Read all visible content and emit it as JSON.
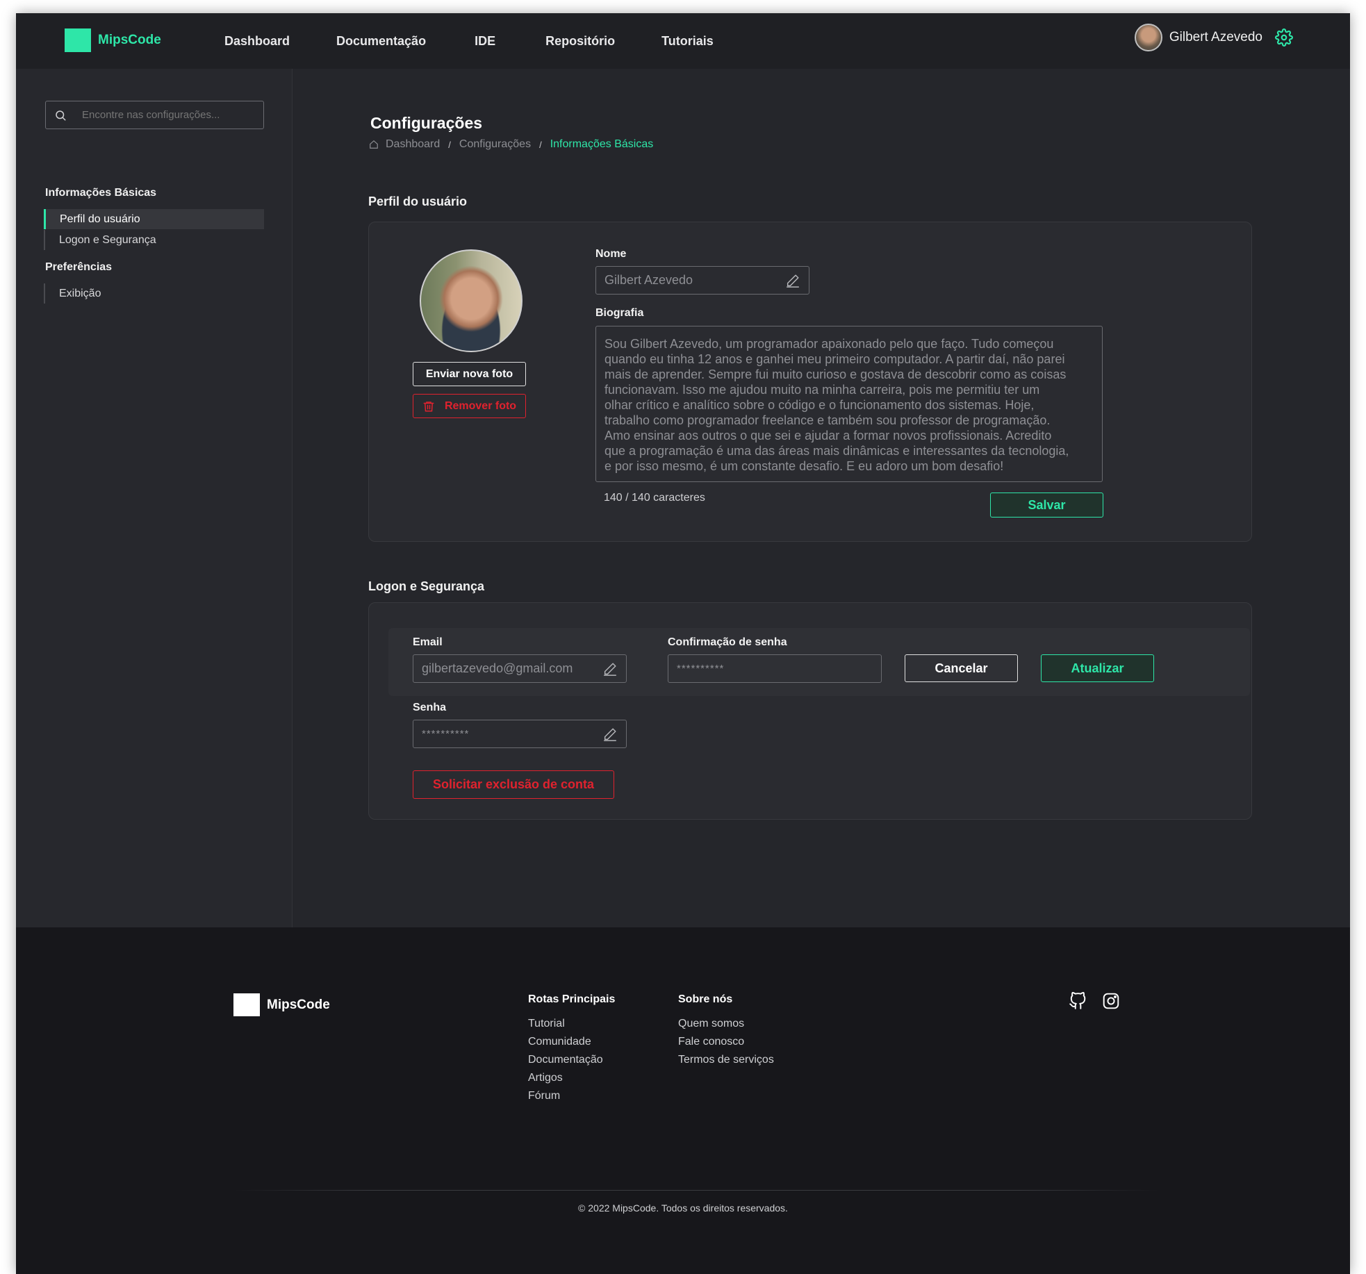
{
  "brand": {
    "name": "MipsCode",
    "accent": "#2ee6a8"
  },
  "nav": {
    "items": [
      "Dashboard",
      "Documentação",
      "IDE",
      "Repositório",
      "Tutoriais"
    ]
  },
  "user": {
    "name": "Gilbert Azevedo"
  },
  "sidebar": {
    "search_placeholder": "Encontre nas configurações...",
    "groups": [
      {
        "title": "Informações Básicas",
        "items": [
          "Perfil do usuário",
          "Logon e Segurança"
        ]
      },
      {
        "title": "Preferências",
        "items": [
          "Exibição"
        ]
      }
    ]
  },
  "page": {
    "title": "Configurações",
    "breadcrumb": [
      "Dashboard",
      "Configurações",
      "Informações Básicas"
    ]
  },
  "profile": {
    "section_title": "Perfil do usuário",
    "upload_label": "Enviar nova foto",
    "remove_label": "Remover foto",
    "name_label": "Nome",
    "name_value": "Gilbert Azevedo",
    "bio_label": "Biografia",
    "bio_lines": [
      "Sou Gilbert Azevedo, um programador apaixonado pelo que faço. Tudo começou",
      "quando eu tinha 12 anos e ganhei meu primeiro computador. A partir daí, não parei",
      "mais de aprender. Sempre fui muito curioso e gostava de descobrir como as coisas",
      "funcionavam. Isso me ajudou muito na minha carreira, pois me permitiu ter um",
      "olhar crítico e analítico sobre o código e o funcionamento dos sistemas. Hoje,",
      "trabalho como programador freelance e também sou professor de programação.",
      "Amo ensinar aos outros o que sei e ajudar a formar novos profissionais. Acredito",
      "que a programação é uma das áreas mais dinâmicas e interessantes da tecnologia,",
      "e por isso mesmo, é um constante desafio. E eu adoro um bom desafio!"
    ],
    "char_count": "140 / 140 caracteres",
    "save_label": "Salvar"
  },
  "security": {
    "section_title": "Logon e Segurança",
    "email_label": "Email",
    "email_value": "gilbertazevedo@gmail.com",
    "confirm_label": "Confirmação de senha",
    "confirm_value": "**********",
    "cancel_label": "Cancelar",
    "update_label": "Atualizar",
    "password_label": "Senha",
    "password_value": "**********",
    "delete_label": "Solicitar exclusão de conta"
  },
  "footer": {
    "brand": "MipsCode",
    "col1": {
      "title": "Rotas Principais",
      "links": [
        "Tutorial",
        "Comunidade",
        "Documentação",
        "Artigos",
        "Fórum"
      ]
    },
    "col2": {
      "title": "Sobre nós",
      "links": [
        "Quem somos",
        "Fale conosco",
        "Termos de serviços"
      ]
    },
    "social_icons": [
      "github-icon",
      "instagram-icon"
    ],
    "copyright": "© 2022 MipsCode. Todos os direitos reservados."
  }
}
